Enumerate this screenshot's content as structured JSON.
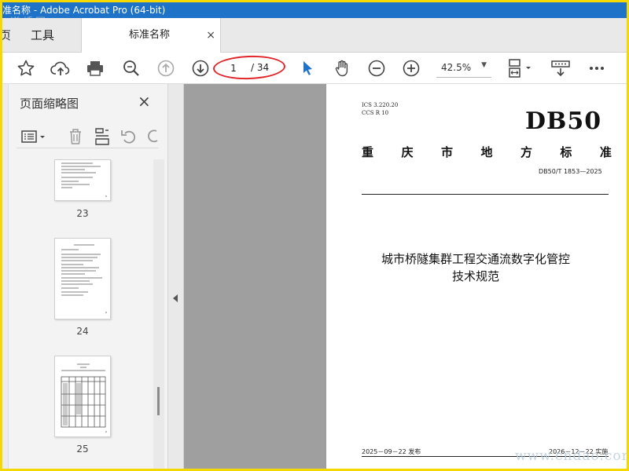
{
  "window": {
    "title": "准名称 - Adobe Acrobat Pro (64-bit)"
  },
  "watermarks": {
    "top": "道桥网",
    "bottom": "www.cndao.com"
  },
  "tabs": {
    "home_partial": "页",
    "tools": "工具",
    "document": "标准名称",
    "close": "×"
  },
  "toolbar": {
    "page_current": "1",
    "page_total": "/ 34",
    "zoom": "42.5%",
    "icons": [
      "star-icon",
      "upload-cloud-icon",
      "print-icon",
      "zoom-search-icon",
      "page-up-icon",
      "page-down-icon",
      "select-pointer-icon",
      "hand-icon",
      "zoom-out-icon",
      "zoom-in-icon",
      "fit-page-icon",
      "scroll-mode-icon",
      "more-icon"
    ],
    "accent_color": "#1e73c9",
    "highlight_color": "#e0262a"
  },
  "sidebar": {
    "title": "页面缩略图",
    "close": "×",
    "thumbnails": [
      {
        "label": "23"
      },
      {
        "label": "24"
      },
      {
        "label": "25"
      }
    ]
  },
  "page": {
    "ics_line1": "ICS 3.220.20",
    "ics_line2": "CCS R 10",
    "db_code": "DB50",
    "standard_chars": [
      "重",
      "庆",
      "市",
      "地",
      "方",
      "标",
      "准"
    ],
    "standard_number": "DB50/T 1853—2025",
    "title_line1": "城市桥隧集群工程交通流数字化管控",
    "title_line2": "技术规范",
    "publish_date": "2025－09－22 发布",
    "implement_date": "2026－12－22 实施"
  }
}
